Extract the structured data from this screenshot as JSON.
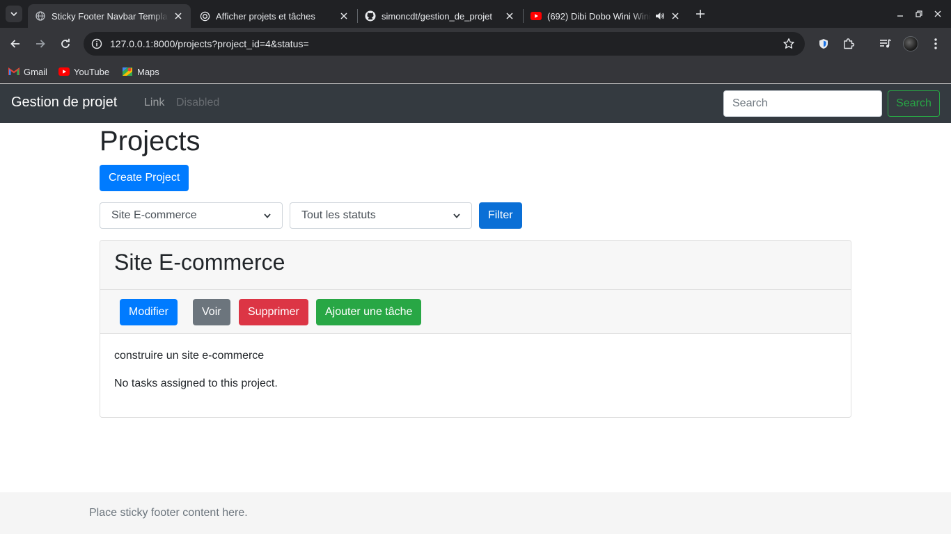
{
  "browser": {
    "tabs": [
      {
        "title": "Sticky Footer Navbar Template",
        "icon": "globe-icon",
        "active": true
      },
      {
        "title": "Afficher projets et tâches",
        "icon": "openai-icon",
        "active": false
      },
      {
        "title": "simoncdt/gestion_de_projet",
        "icon": "github-icon",
        "active": false
      },
      {
        "title": "(692) Dibi Dobo Wini Wini",
        "icon": "youtube-icon",
        "active": false
      }
    ],
    "url": "127.0.0.1:8000/projects?project_id=4&status=",
    "bookmarks": [
      {
        "label": "Gmail",
        "icon": "gmail-icon"
      },
      {
        "label": "YouTube",
        "icon": "youtube-icon"
      },
      {
        "label": "Maps",
        "icon": "maps-icon"
      }
    ]
  },
  "navbar": {
    "brand": "Gestion de projet",
    "links": [
      "Link",
      "Disabled"
    ],
    "search_placeholder": "Search",
    "search_button": "Search"
  },
  "main": {
    "title": "Projects",
    "create_button": "Create Project",
    "filters": {
      "project_selected": "Site E-commerce",
      "status_selected": "Tout les statuts",
      "filter_button": "Filter"
    },
    "project_card": {
      "title": "Site E-commerce",
      "actions": {
        "edit": "Modifier",
        "view": "Voir",
        "delete": "Supprimer",
        "add_task": "Ajouter une tâche"
      },
      "description": "construire un site e-commerce",
      "empty_tasks": "No tasks assigned to this project."
    }
  },
  "footer": {
    "text": "Place sticky footer content here."
  },
  "colors": {
    "navbar_bg": "#343a40",
    "primary": "#007bff",
    "secondary": "#6c757d",
    "danger": "#dc3545",
    "success": "#28a745"
  }
}
